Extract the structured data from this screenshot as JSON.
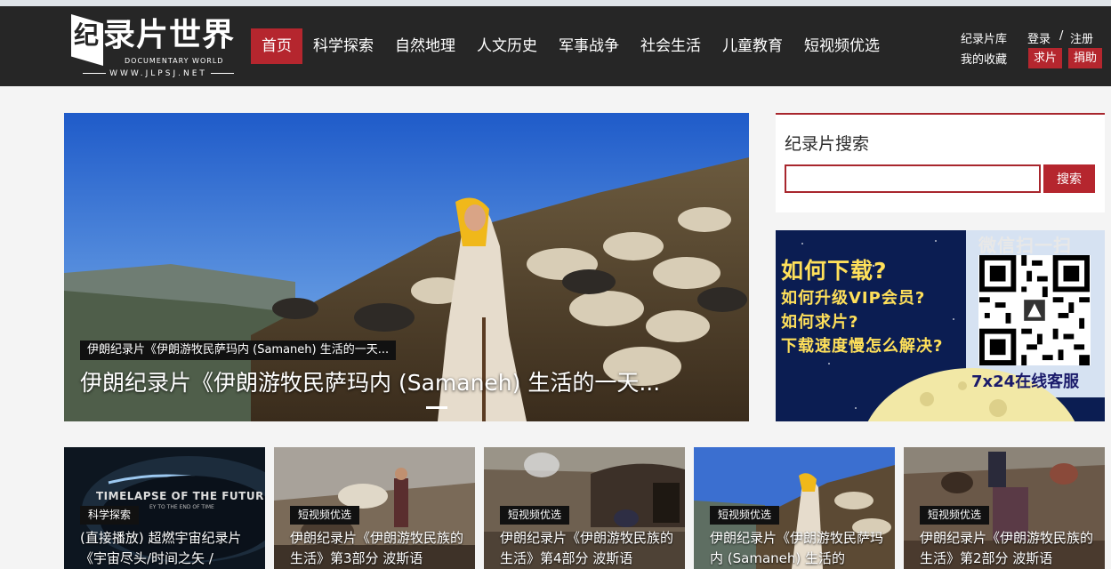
{
  "header": {
    "logo": {
      "glyph": "纪",
      "title": "录片世界",
      "subtitle": "DOCUMENTARY WORLD",
      "url": "WWW.JLPSJ.NET"
    },
    "nav": [
      {
        "label": "首页",
        "active": true
      },
      {
        "label": "科学探索"
      },
      {
        "label": "自然地理"
      },
      {
        "label": "人文历史"
      },
      {
        "label": "军事战争"
      },
      {
        "label": "社会生活"
      },
      {
        "label": "儿童教育"
      },
      {
        "label": "短视频优选"
      }
    ],
    "util": {
      "library": "纪录片库",
      "favorites": "我的收藏",
      "login": "登录",
      "slash": "/",
      "register": "注册",
      "request": "求片",
      "donate": "捐助"
    }
  },
  "hero": {
    "caption_small": "伊朗纪录片《伊朗游牧民萨玛内 (Samaneh) 生活的一天...",
    "title": "伊朗纪录片《伊朗游牧民萨玛内 (Samaneh) 生活的一天..."
  },
  "search": {
    "title": "纪录片搜索",
    "placeholder": "",
    "value": "",
    "button": "搜索"
  },
  "ad": {
    "scan": "微信扫一扫",
    "title": "如何下载?",
    "lines": [
      "如何升级VIP会员?",
      "如何求片?",
      "下载速度慢怎么解决?"
    ],
    "service": "7x24在线客服"
  },
  "cards": [
    {
      "tag": "科学探索",
      "title": "(直接播放) 超燃宇宙纪录片《宇宙尽头/时间之矢 /",
      "overlay": "TIMELAPSE OF THE FUTURE",
      "overlay_sub": "EY TO THE END OF TIME"
    },
    {
      "tag": "短视频优选",
      "title": "伊朗纪录片《伊朗游牧民族的生活》第3部分 波斯语"
    },
    {
      "tag": "短视频优选",
      "title": "伊朗纪录片《伊朗游牧民族的生活》第4部分 波斯语"
    },
    {
      "tag": "短视频优选",
      "title": "伊朗纪录片《伊朗游牧民萨玛内 (Samaneh) 生活的"
    },
    {
      "tag": "短视频优选",
      "title": "伊朗纪录片《伊朗游牧民族的生活》第2部分 波斯语"
    }
  ],
  "colors": {
    "header_bg": "#262626",
    "accent": "#b5262e",
    "page_bg": "#f4f4f4"
  }
}
